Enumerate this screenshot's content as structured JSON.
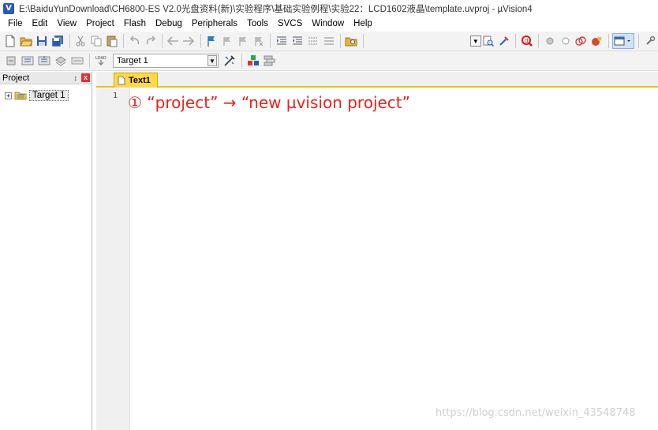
{
  "window": {
    "title": "E:\\BaiduYunDownload\\CH6800-ES V2.0光盘资料(新)\\实验程序\\基础实验例程\\实验22：LCD1602液晶\\template.uvproj - µVision4",
    "app_icon_label": "V"
  },
  "menu": [
    "File",
    "Edit",
    "View",
    "Project",
    "Flash",
    "Debug",
    "Peripherals",
    "Tools",
    "SVCS",
    "Window",
    "Help"
  ],
  "toolbar2": {
    "target_value": "Target 1"
  },
  "project_panel": {
    "title": "Project",
    "pin_glyph": "↕",
    "close_glyph": "x",
    "tree": [
      {
        "expander": "+",
        "label": "Target 1"
      }
    ]
  },
  "editor": {
    "tab_label": "Text1",
    "line_numbers": [
      "1"
    ],
    "annotation": "① “project” → “new µvision project”",
    "watermark": "https://blog.csdn.net/weixin_43548748"
  },
  "colors": {
    "annotation_red": "#e8231b",
    "tab_yellow": "#ffd84a",
    "app_icon_blue": "#2a5bb3"
  },
  "icons": {
    "toolbar1": [
      "new-file-icon",
      "open-folder-icon",
      "save-icon",
      "save-all-icon",
      "cut-icon",
      "copy-icon",
      "paste-icon",
      "undo-icon",
      "redo-icon",
      "nav-back-icon",
      "nav-forward-icon",
      "bookmark-icon",
      "prev-bookmark-icon",
      "next-bookmark-icon",
      "clear-bookmarks-icon",
      "indent-icon",
      "unindent-icon",
      "comment-icon",
      "uncomment-icon",
      "find-in-files-icon",
      "find-dropdown-icon",
      "find-icon",
      "incremental-find-icon",
      "debug-session-icon",
      "breakpoint-icon",
      "breakpoint-disable-icon",
      "breakpoint-kill-icon",
      "breakpoint-clear-icon",
      "window-layout-icon",
      "configure-icon"
    ],
    "toolbar2": [
      "translate-icon",
      "build-icon",
      "rebuild-icon",
      "batch-build-icon",
      "stop-build-icon",
      "download-icon",
      "target-options-icon",
      "manage-components-icon",
      "select-books-icon"
    ]
  }
}
